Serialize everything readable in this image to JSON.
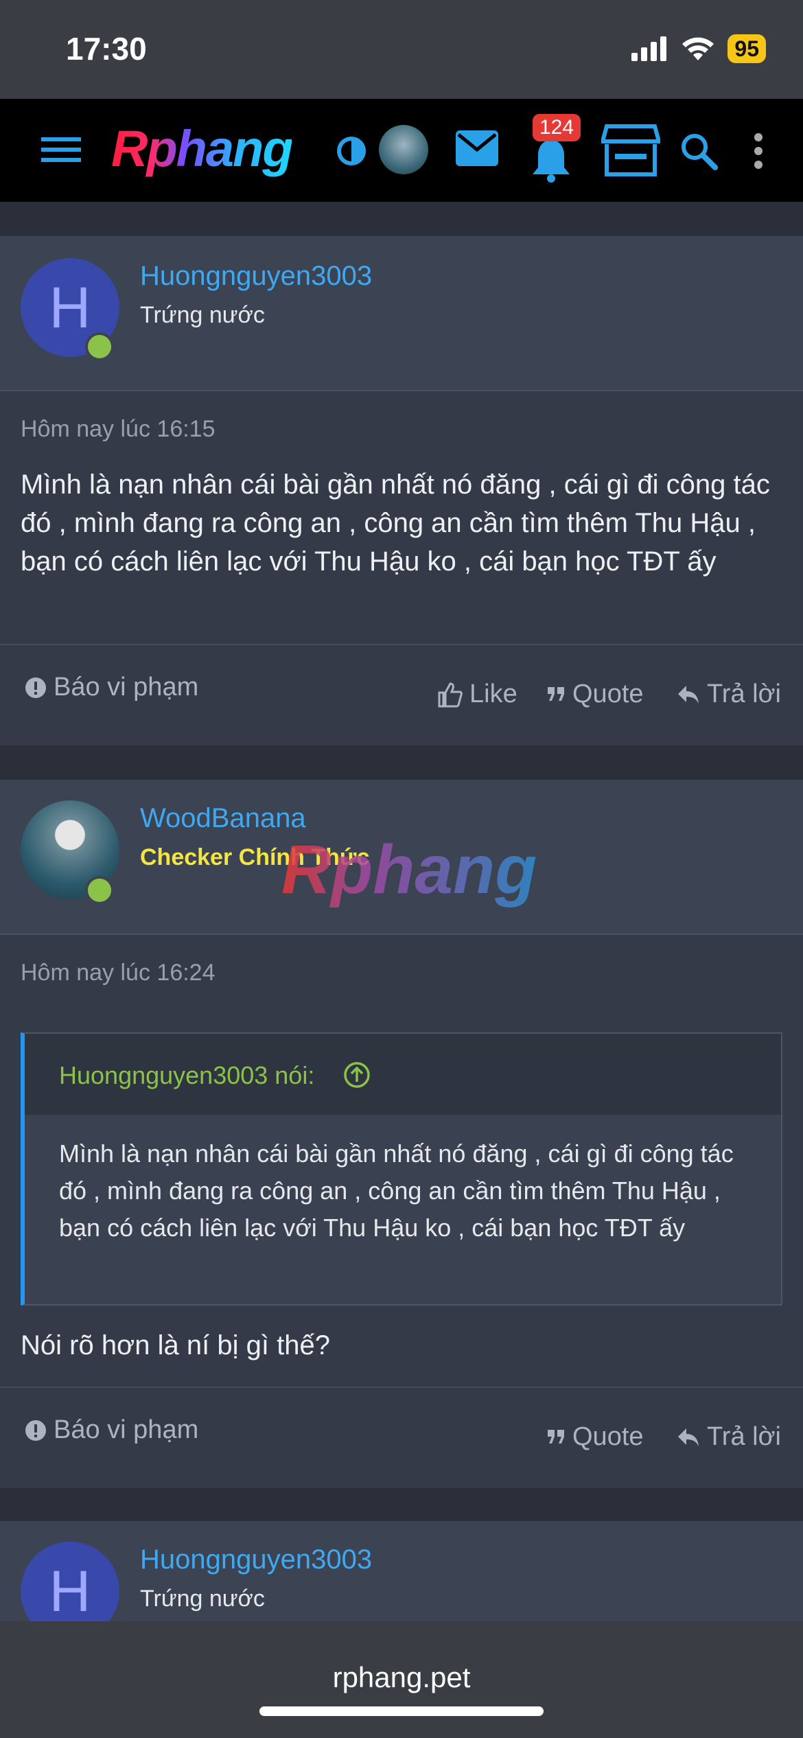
{
  "status_bar": {
    "time": "17:30",
    "battery": "95"
  },
  "nav": {
    "logo": "Rphang",
    "notification_count": "124"
  },
  "posts": [
    {
      "username": "Huongnguyen3003",
      "user_title": "Trứng nước",
      "avatar_letter": "H",
      "timestamp": "Hôm nay lúc 16:15",
      "body": "Mình là nạn nhân cái bài gần nhất nó đăng , cái gì đi công tác đó , mình đang ra công an , công an cần tìm thêm Thu Hậu , bạn có cách liên lạc với Thu Hậu ko , cái bạn học TĐT ấy",
      "actions": {
        "report": "Báo vi phạm",
        "like": "Like",
        "quote": "Quote",
        "reply": "Trả lời"
      }
    },
    {
      "username": "WoodBanana",
      "user_title": "Checker Chính Thức",
      "timestamp": "Hôm nay lúc 16:24",
      "quote": {
        "author": "Huongnguyen3003 nói:",
        "text": "Mình là nạn nhân cái bài gần nhất nó đăng , cái gì đi công tác đó , mình đang ra công an , công an cần tìm thêm Thu Hậu , bạn có cách liên lạc với Thu Hậu ko , cái bạn học TĐT ấy"
      },
      "body": "Nói rõ hơn là ní bị gì thế?",
      "actions": {
        "report": "Báo vi phạm",
        "quote": "Quote",
        "reply": "Trả lời"
      }
    },
    {
      "username": "Huongnguyen3003",
      "user_title": "Trứng nước",
      "avatar_letter": "H"
    }
  ],
  "watermark": "Rphang",
  "url_bar": {
    "url": "rphang.pet"
  },
  "colors": {
    "accent": "#3ea8f0",
    "online": "#8bc34a",
    "checker": "#f4e542",
    "badge": "#e53935"
  }
}
